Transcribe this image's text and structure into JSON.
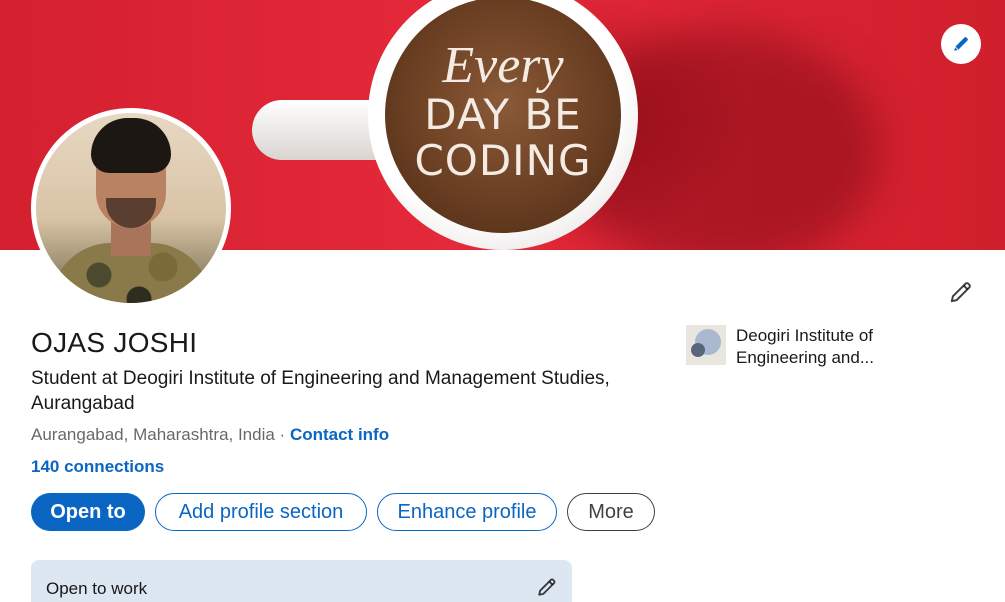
{
  "banner": {
    "mug_text_line1": "Every",
    "mug_text_line2": "DAY BE",
    "mug_text_line3": "CODING",
    "edit_icon": "pencil-icon",
    "background_color": "#d8232e"
  },
  "profile": {
    "name": "OJAS JOSHI",
    "headline": "Student at Deogiri Institute of Engineering and Management Studies, Aurangabad",
    "location": "Aurangabad, Maharashtra, India",
    "separator": " · ",
    "contact_info": "Contact info",
    "connections": "140 connections",
    "edit_icon": "pencil-icon"
  },
  "education": {
    "org_name": "Deogiri Institute of Engineering and..."
  },
  "actions": {
    "open_to": "Open to",
    "add_profile_section": "Add profile section",
    "enhance_profile": "Enhance profile",
    "more": "More"
  },
  "open_to_work": {
    "title": "Open to work",
    "edit_icon": "pencil-icon"
  },
  "colors": {
    "accent": "#0a66c2",
    "card_highlight": "#dde7f1"
  }
}
